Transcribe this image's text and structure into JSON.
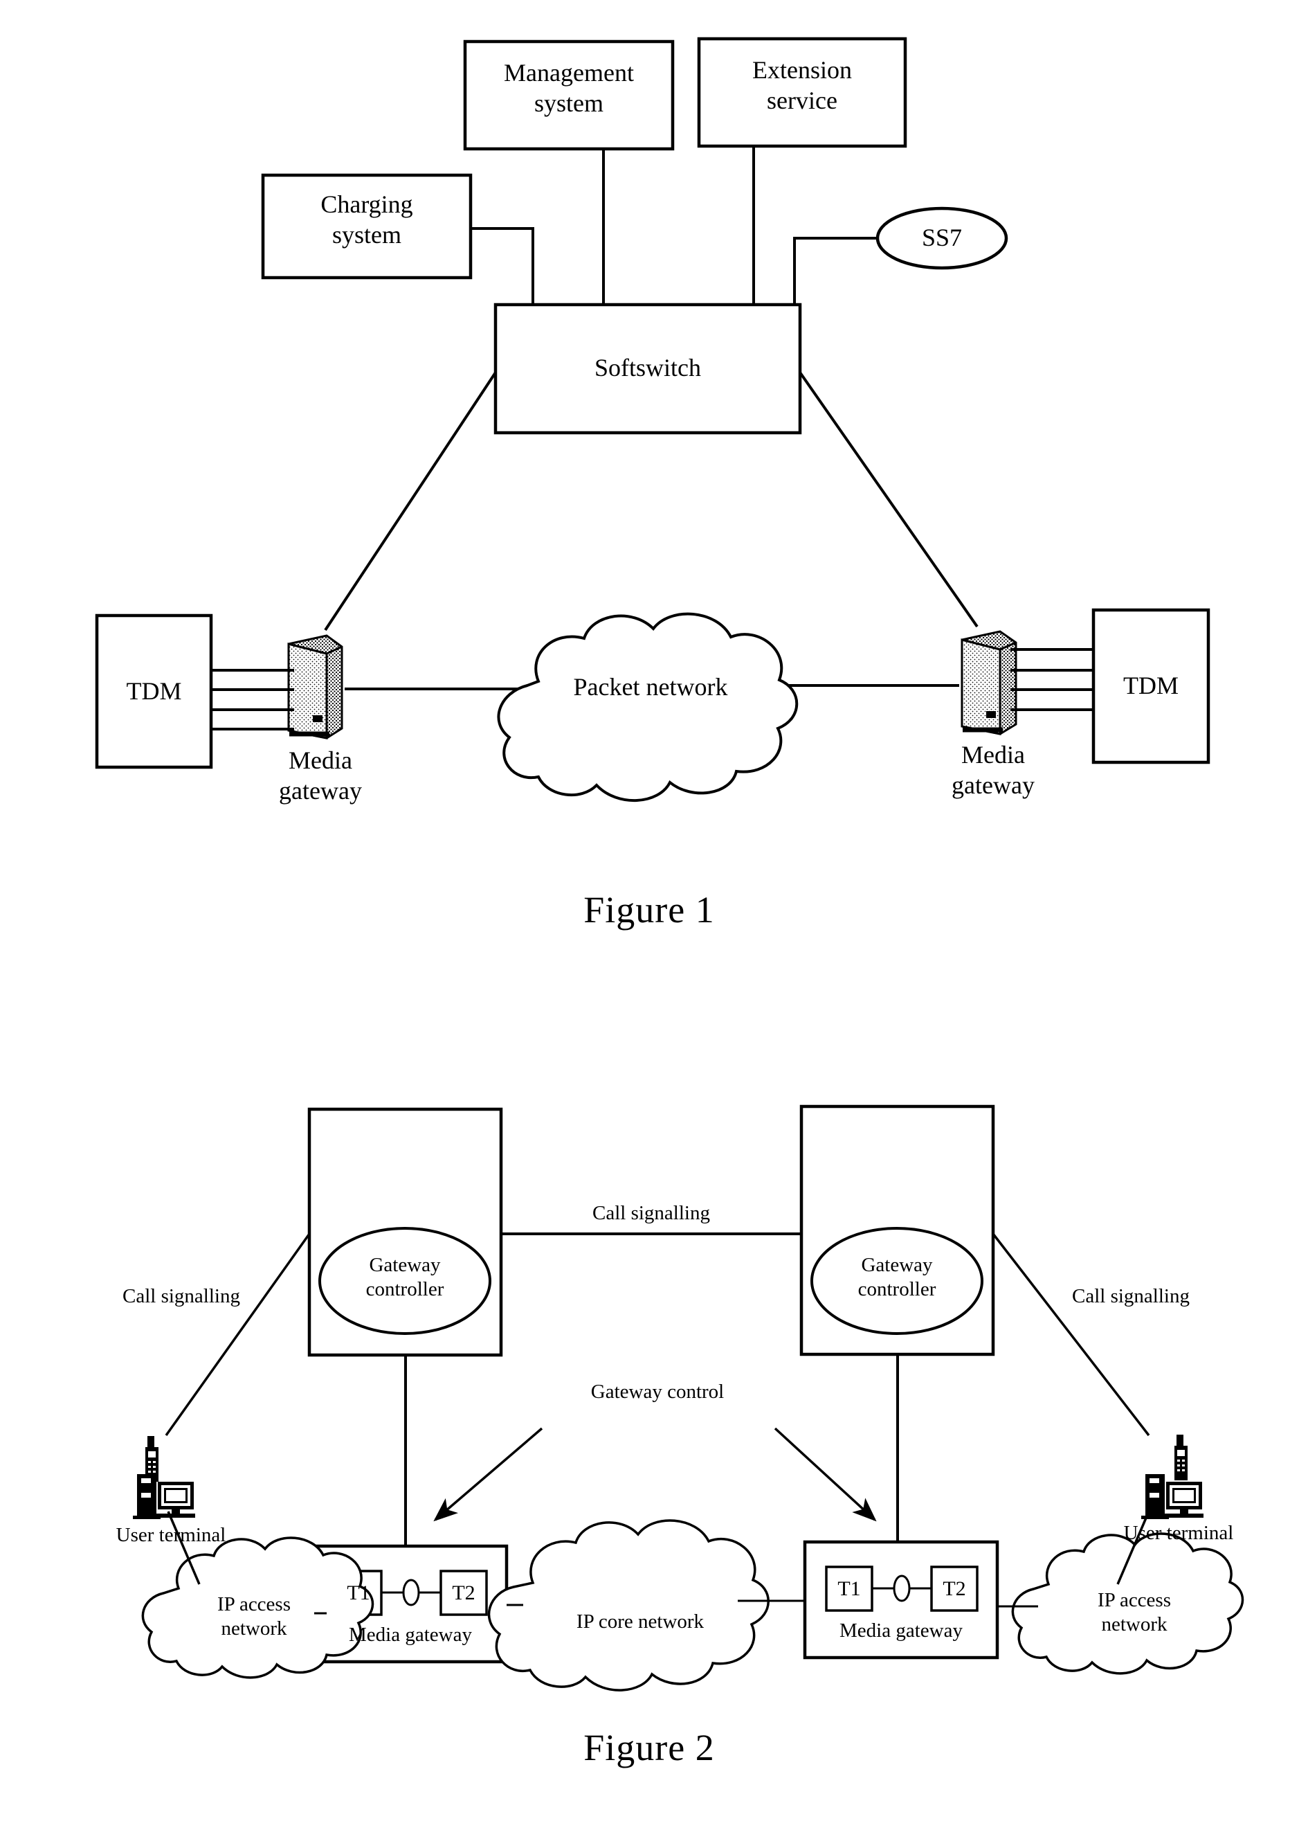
{
  "document": {
    "type": "patent-drawing-sheet",
    "background": "#ffffff",
    "ink_color": "#000000"
  },
  "figure1": {
    "caption": "Figure 1",
    "nodes": {
      "management_system": "Management\nsystem",
      "extension_service": "Extension\nservice",
      "charging_system": "Charging\nsystem",
      "ss7": "SS7",
      "softswitch": "Softswitch",
      "tdm_left": "TDM",
      "tdm_right": "TDM",
      "media_gateway_left": "Media\ngateway",
      "media_gateway_right": "Media\ngateway",
      "packet_network": "Packet network"
    }
  },
  "figure2": {
    "caption": "Figure 2",
    "nodes": {
      "gateway_controller_left": "Gateway\ncontroller",
      "gateway_controller_right": "Gateway\ncontroller",
      "media_gateway_left": "Media gateway",
      "media_gateway_right": "Media gateway",
      "t1_left": "T1",
      "t2_left": "T2",
      "t1_right": "T1",
      "t2_right": "T2",
      "ip_core_network": "IP core network",
      "ip_access_network_left": "IP access\nnetwork",
      "ip_access_network_right": "IP access\nnetwork",
      "user_terminal_left": "User terminal",
      "user_terminal_right": "User terminal"
    },
    "edge_labels": {
      "call_signalling_left": "Call signalling",
      "call_signalling_center": "Call signalling",
      "call_signalling_right": "Call signalling",
      "gateway_control": "Gateway control"
    }
  }
}
